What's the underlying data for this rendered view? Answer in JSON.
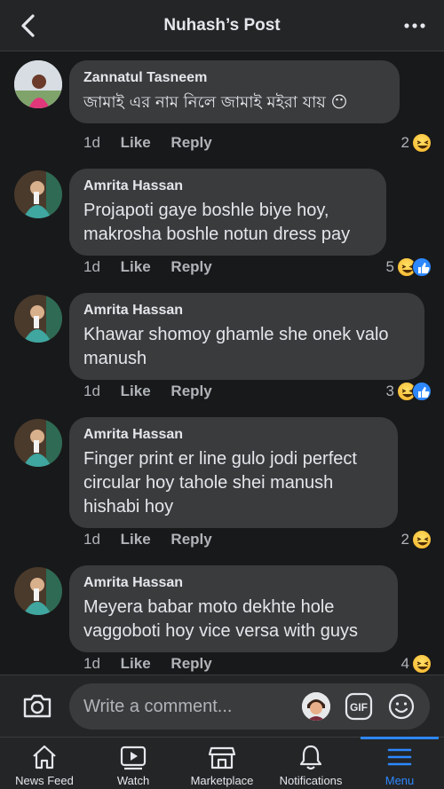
{
  "header": {
    "title": "Nuhash’s Post",
    "back_icon": "chevron-left-icon",
    "more_icon": "ellipsis-icon"
  },
  "comments": [
    {
      "author": "Zannatul Tasneem",
      "text": "জামাই এর নাম নিলে জামাই মইরা যায় 😶",
      "time": "1d",
      "like": "Like",
      "reply": "Reply",
      "reaction_count": "2",
      "reactions": [
        "haha"
      ]
    },
    {
      "author": "Amrita Hassan",
      "text": "Projapoti gaye boshle biye hoy,\nmakrosha boshle notun dress pay",
      "time": "1d",
      "like": "Like",
      "reply": "Reply",
      "reaction_count": "5",
      "reactions": [
        "haha",
        "like"
      ]
    },
    {
      "author": "Amrita Hassan",
      "text": "Khawar shomoy ghamle she onek valo\nmanush",
      "time": "1d",
      "like": "Like",
      "reply": "Reply",
      "reaction_count": "3",
      "reactions": [
        "haha",
        "like"
      ]
    },
    {
      "author": "Amrita Hassan",
      "text": "Finger print er line gulo jodi perfect\ncircular hoy tahole shei manush\nhishabi hoy",
      "time": "1d",
      "like": "Like",
      "reply": "Reply",
      "reaction_count": "2",
      "reactions": [
        "haha"
      ]
    },
    {
      "author": "Amrita Hassan",
      "text": "Meyera babar moto dekhte hole\nvaggoboti hoy vice versa with guys",
      "time": "1d",
      "like": "Like",
      "reply": "Reply",
      "reaction_count": "4",
      "reactions": [
        "haha"
      ]
    }
  ],
  "composer": {
    "placeholder": "Write a comment...",
    "gif_label": "GIF"
  },
  "tabs": [
    {
      "label": "News Feed",
      "icon": "home-icon"
    },
    {
      "label": "Watch",
      "icon": "watch-icon"
    },
    {
      "label": "Marketplace",
      "icon": "marketplace-icon"
    },
    {
      "label": "Notifications",
      "icon": "bell-icon"
    },
    {
      "label": "Menu",
      "icon": "menu-icon",
      "active": true
    }
  ],
  "colors": {
    "background": "#18191a",
    "bubble": "#3a3b3c",
    "accent": "#2d88ff",
    "haha": "#f7b125"
  }
}
